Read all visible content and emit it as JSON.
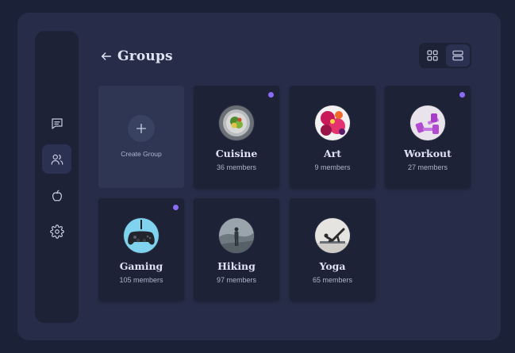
{
  "header": {
    "title": "Groups"
  },
  "create_card": {
    "label": "Create Group",
    "icon": "plus-icon"
  },
  "sidebar": {
    "items": [
      {
        "name": "messages",
        "icon": "chat-icon",
        "active": false
      },
      {
        "name": "groups",
        "icon": "users-icon",
        "active": true
      },
      {
        "name": "activity",
        "icon": "apple-icon",
        "active": false
      },
      {
        "name": "settings",
        "icon": "gear-icon",
        "active": false
      }
    ]
  },
  "view_toggle": {
    "options": [
      {
        "name": "grid",
        "icon": "grid-view-icon",
        "active": false
      },
      {
        "name": "list",
        "icon": "list-view-icon",
        "active": true
      }
    ]
  },
  "groups": [
    {
      "name": "Cuisine",
      "members": "36 members",
      "unread": true,
      "image": "food-plate"
    },
    {
      "name": "Art",
      "members": "9 members",
      "unread": false,
      "image": "flowers"
    },
    {
      "name": "Workout",
      "members": "27 members",
      "unread": true,
      "image": "dumbbells"
    },
    {
      "name": "Gaming",
      "members": "105 members",
      "unread": true,
      "image": "game-controller"
    },
    {
      "name": "Hiking",
      "members": "97 members",
      "unread": false,
      "image": "hiker"
    },
    {
      "name": "Yoga",
      "members": "65 members",
      "unread": false,
      "image": "yoga-pose"
    }
  ],
  "colors": {
    "background": "#1b2137",
    "window": "#272d48",
    "panel": "#1d2237",
    "accent": "#8b6cf6",
    "text": "#dfe3f3",
    "muted": "#aeb4cc"
  }
}
